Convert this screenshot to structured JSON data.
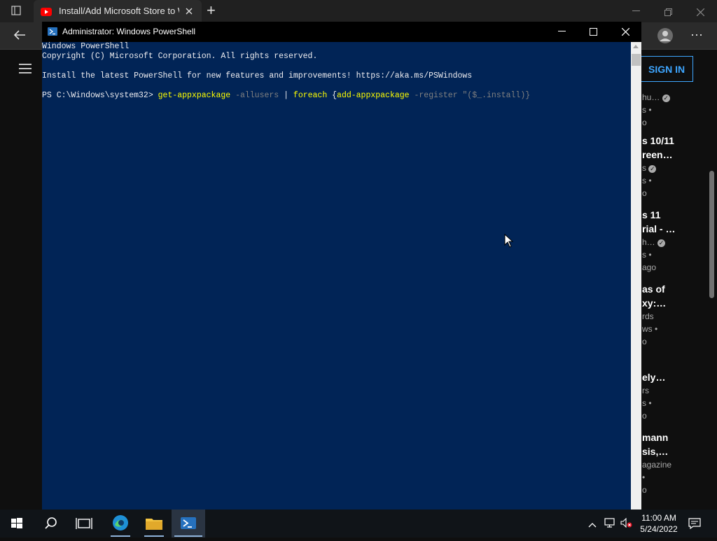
{
  "browser": {
    "tab_title": "Install/Add Microsoft Store to W",
    "new_tab_glyph": "+",
    "sign_in": "SIGN IN",
    "more_glyph": "⋯"
  },
  "sidebar_fragments": [
    {
      "title": "",
      "meta": [
        "hu…",
        "s •",
        "o"
      ]
    },
    {
      "title": "s 10/11\nreen…",
      "meta": [
        "s",
        "s •",
        "o"
      ]
    },
    {
      "title": "s 11\nrial - …",
      "meta": [
        "h…",
        "s •",
        "ago"
      ]
    },
    {
      "title": "as of\nxy:…",
      "meta": [
        "rds",
        "ws •",
        "o"
      ]
    },
    {
      "title": "ely…",
      "meta": [
        "rs",
        "s •",
        "o"
      ]
    },
    {
      "title": "mann\nsis,…",
      "meta": [
        "agazine",
        "•",
        "o"
      ]
    }
  ],
  "powershell": {
    "title": "Administrator: Windows PowerShell",
    "lines": [
      "Windows PowerShell",
      "Copyright (C) Microsoft Corporation. All rights reserved.",
      "",
      "Install the latest PowerShell for new features and improvements! https://aka.ms/PSWindows"
    ],
    "prompt": "PS C:\\Windows\\system32>",
    "cmd1": "get-appxpackage",
    "param1": "-allusers",
    "pipe": "|",
    "cmd2": "foreach",
    "brace_open": "{",
    "cmd3": "add-appxpackage",
    "param2": "-register",
    "string": "\"($_.install)}"
  },
  "taskbar": {
    "time": "11:00 AM",
    "date": "5/24/2022"
  },
  "colors": {
    "ps_background": "#012456",
    "ps_command": "#ffff00",
    "ps_param": "#808080",
    "signin_accent": "#3ea6ff"
  }
}
